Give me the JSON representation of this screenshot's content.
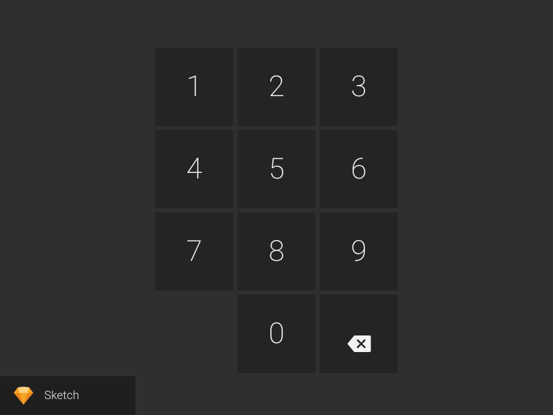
{
  "keypad": {
    "keys": [
      "1",
      "2",
      "3",
      "4",
      "5",
      "6",
      "7",
      "8",
      "9",
      "",
      "0",
      ""
    ]
  },
  "footer": {
    "label": "Sketch"
  },
  "colors": {
    "bg": "#2e2f30",
    "key_bg": "#232424",
    "key_fg": "#f3f2f1",
    "accent": "#f6a623",
    "footer_bg": "#1f1f1f"
  }
}
